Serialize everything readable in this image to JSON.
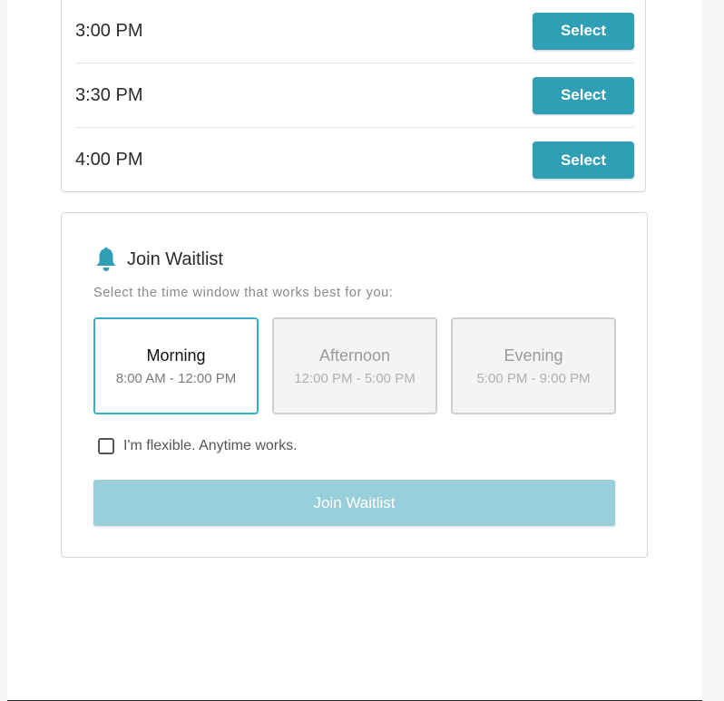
{
  "time_slots": [
    {
      "time": "3:00 PM",
      "button_label": "Select"
    },
    {
      "time": "3:30 PM",
      "button_label": "Select"
    },
    {
      "time": "4:00 PM",
      "button_label": "Select"
    }
  ],
  "waitlist": {
    "icon": "bell-icon",
    "title": "Join Waitlist",
    "subtitle": "Select the time window that works best for you:",
    "windows": [
      {
        "name": "Morning",
        "range": "8:00 AM - 12:00 PM",
        "selected": true
      },
      {
        "name": "Afternoon",
        "range": "12:00 PM - 5:00 PM",
        "selected": false
      },
      {
        "name": "Evening",
        "range": "5:00 PM - 9:00 PM",
        "selected": false
      }
    ],
    "flexible_label": "I'm flexible. Anytime works.",
    "flexible_checked": false,
    "join_button_label": "Join Waitlist",
    "join_button_enabled": false
  },
  "colors": {
    "accent": "#2f9fb6",
    "selected_border": "#2fb1c8",
    "disabled_button": "#98cfdb"
  }
}
